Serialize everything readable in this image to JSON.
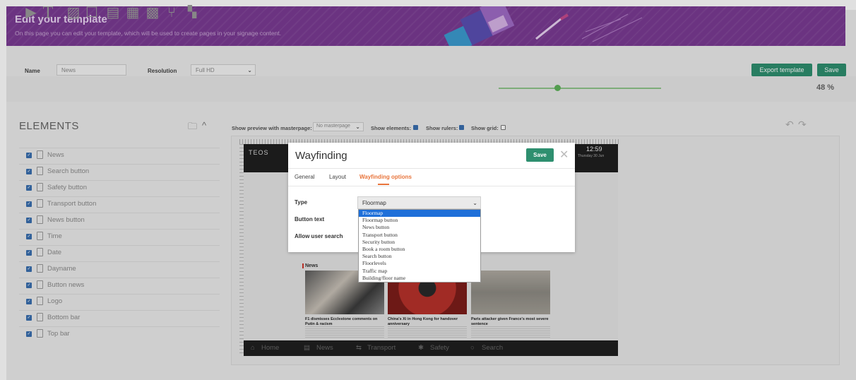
{
  "banner": {
    "title": "Edit your template",
    "subtitle": "On this page you can edit your template, which will be used to create pages in your signage content."
  },
  "toolbar": {
    "name_label": "Name",
    "name_value": "News",
    "resolution_label": "Resolution",
    "resolution_value": "Full HD",
    "export_label": "Export template",
    "save_label": "Save",
    "zoom": "48 %",
    "zoom_level": 0.48
  },
  "elements": {
    "title": "ELEMENTS",
    "items": [
      {
        "label": "News"
      },
      {
        "label": "Search button"
      },
      {
        "label": "Safety button"
      },
      {
        "label": "Transport button"
      },
      {
        "label": "News button"
      },
      {
        "label": "Time"
      },
      {
        "label": "Date"
      },
      {
        "label": "Dayname"
      },
      {
        "label": "Button news"
      },
      {
        "label": "Logo"
      },
      {
        "label": "Bottom bar"
      },
      {
        "label": "Top bar"
      }
    ]
  },
  "preview": {
    "masterpage_label": "Show preview with masterpage:",
    "masterpage_value": "No masterpage",
    "show_elements_label": "Show elements:",
    "show_rulers_label": "Show rulers:",
    "show_grid_label": "Show grid:",
    "show_elements": true,
    "show_rulers": true,
    "show_grid": false
  },
  "screen": {
    "logo": "TEOS",
    "time": "12:59",
    "date": "Thursday 30 Jun",
    "news_heading": "News",
    "captions": [
      "F1 dismisses Ecclestone comments on Putin & racism",
      "China's Xi in Hong Kong for handover anniversary",
      "Paris attacker given France's most severe sentence"
    ],
    "nav": [
      "Home",
      "News",
      "Transport",
      "Safety",
      "Search"
    ]
  },
  "modal": {
    "title": "Wayfinding",
    "save_label": "Save",
    "tabs": [
      "General",
      "Layout",
      "Wayfinding options"
    ],
    "active_tab": "Wayfinding options",
    "type_label": "Type",
    "type_value": "Floormap",
    "button_text_label": "Button text",
    "allow_search_label": "Allow user search"
  },
  "dropdown": {
    "options": [
      "Floormap",
      "Floormap button",
      "News button",
      "Transport button",
      "Security button",
      "Book a room button",
      "Search button",
      "Floorlevels",
      "Traffic map",
      "Building/floor name"
    ],
    "selected": "Floormap"
  },
  "colors": {
    "banner": "#7a3b93",
    "accent_green": "#2e8f6f",
    "tab_active": "#e8743b",
    "dropdown_highlight": "#1e6fd9"
  }
}
